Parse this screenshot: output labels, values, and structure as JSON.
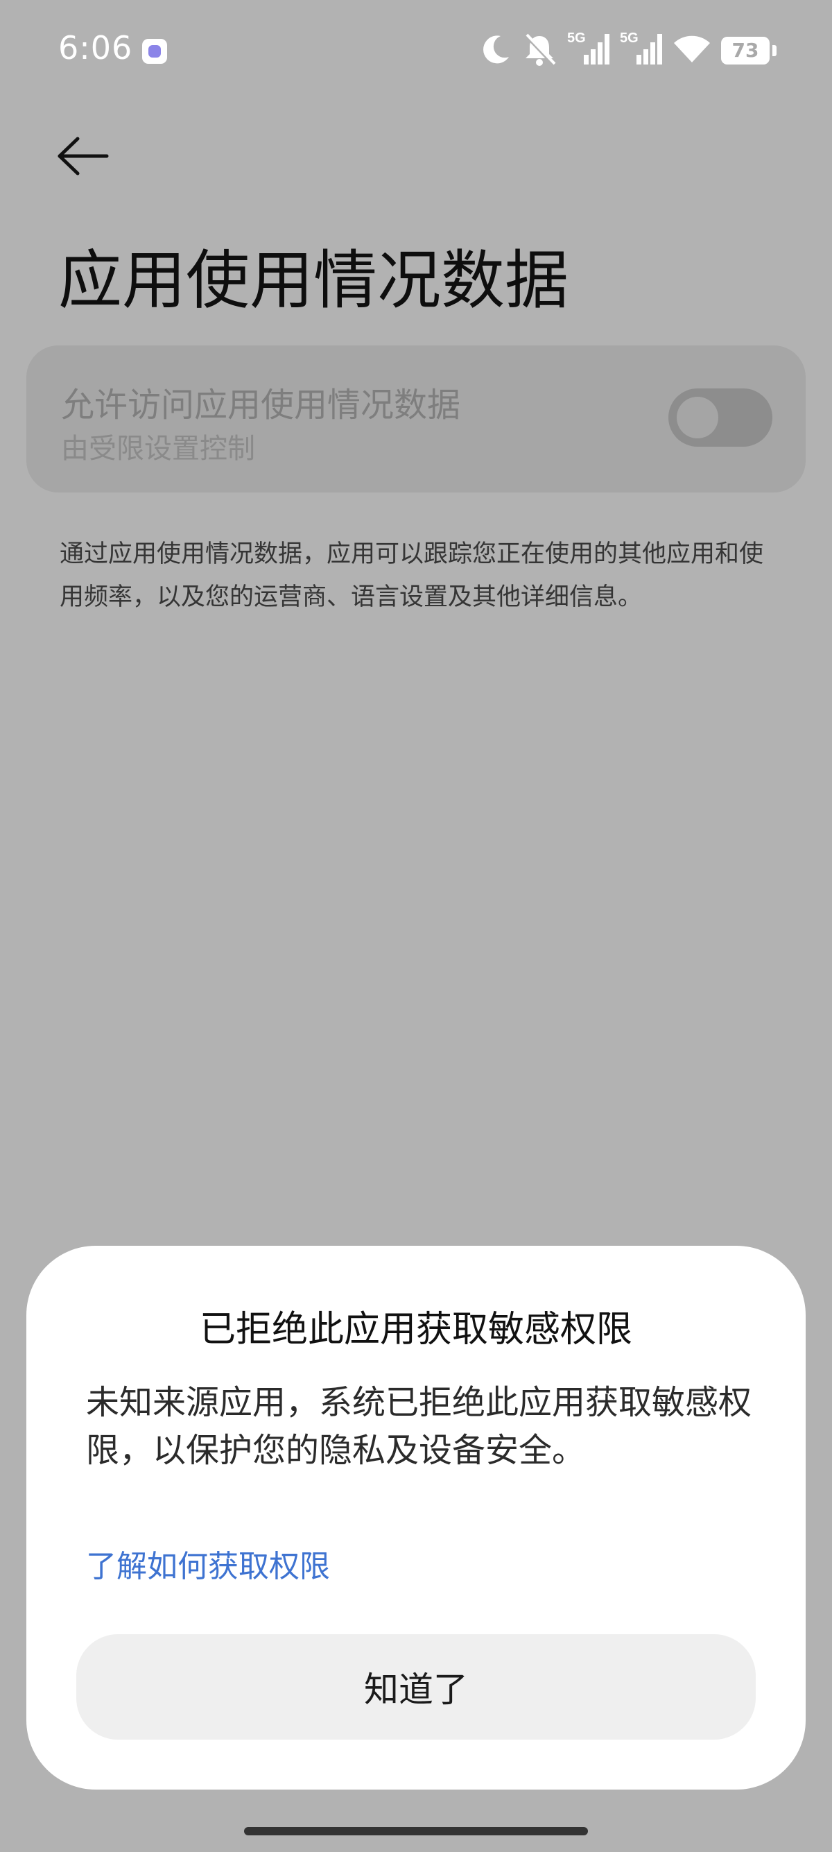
{
  "status_bar": {
    "time": "6:06",
    "battery": "73",
    "network_1": "5G",
    "network_2": "5G"
  },
  "page": {
    "title": "应用使用情况数据",
    "setting": {
      "title": "允许访问应用使用情况数据",
      "subtitle": "由受限设置控制",
      "enabled": false
    },
    "description": "通过应用使用情况数据，应用可以跟踪您正在使用的其他应用和使用频率，以及您的运营商、语言设置及其他详细信息。"
  },
  "dialog": {
    "title": "已拒绝此应用获取敏感权限",
    "body": "未知来源应用，系统已拒绝此应用获取敏感权限，以保护您的隐私及设备安全。",
    "link": "了解如何获取权限",
    "button": "知道了"
  },
  "colors": {
    "scrim": "#b2b2b2",
    "link": "#3e73d1",
    "dialog_bg": "#ffffff",
    "button_bg": "#efefef"
  },
  "icons": {
    "back": "arrow-left-icon",
    "moon": "moon-icon",
    "mute": "bell-off-icon",
    "signal": "signal-icon",
    "wifi": "wifi-icon",
    "battery": "battery-icon"
  }
}
